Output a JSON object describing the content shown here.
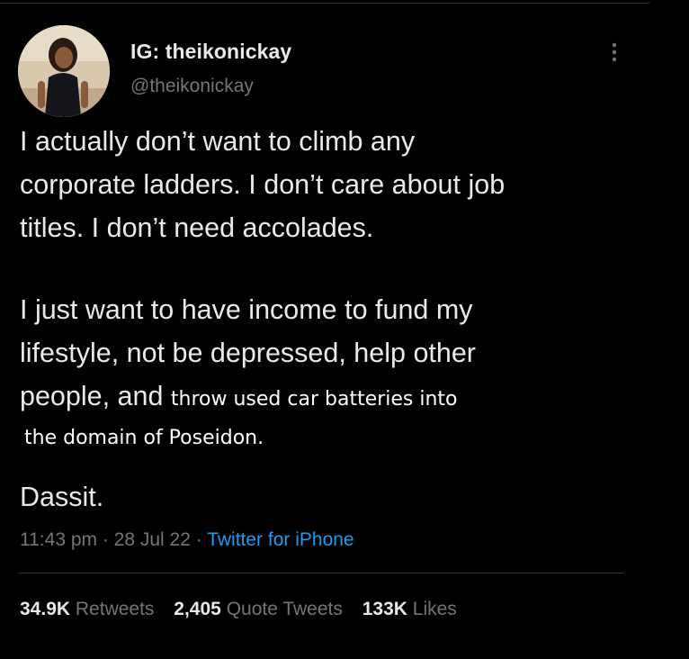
{
  "author": {
    "display_name": "IG: theikonickay",
    "handle": "@theikonickay",
    "avatar_icon": "profile-photo"
  },
  "tweet": {
    "paragraph1_lines": [
      "I actually don’t want to climb any",
      "corporate ladders. I don’t care about job",
      "titles. I don’t need accolades."
    ],
    "paragraph2_lines": [
      "I just want to have income to fund my",
      "lifestyle, not be depressed, help other"
    ],
    "paragraph2_line3_original": "people, and ",
    "paragraph2_line3_edited": "throw used car batteries into",
    "paragraph2_line4_edited": "the domain of Poseidon.",
    "signoff": "Dassit."
  },
  "meta": {
    "time": "11:43 pm",
    "sep1": " · ",
    "date": "28 Jul 22",
    "sep2": " · ",
    "source": "Twitter for iPhone"
  },
  "stats": {
    "retweets_count": "34.9K",
    "retweets_label": "Retweets",
    "quotes_count": "2,405",
    "quotes_label": "Quote Tweets",
    "likes_count": "133K",
    "likes_label": "Likes"
  },
  "colors": {
    "background": "#000000",
    "text": "#e7e9ea",
    "secondary": "#71767b",
    "link": "#1d9bf0",
    "divider": "#2f3336"
  }
}
